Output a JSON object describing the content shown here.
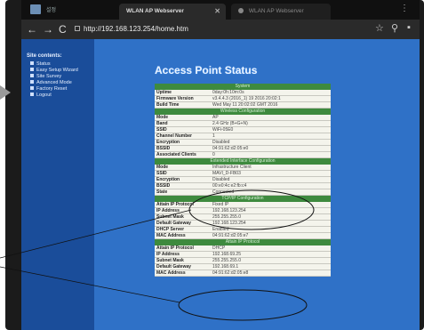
{
  "browser": {
    "app_label": "설정",
    "tab_active_title": "WLAN AP Webserver",
    "tab_inactive_title": "WLAN AP Webserver",
    "url": "http://192.168.123.254/home.htm"
  },
  "sidebar": {
    "title": "Site contents:",
    "items": [
      {
        "label": "Status"
      },
      {
        "label": "Easy Setup Wizard"
      },
      {
        "label": "Site Survey"
      },
      {
        "label": "Advanced Mode"
      },
      {
        "label": "Factory Reset"
      },
      {
        "label": "Logout"
      }
    ]
  },
  "main": {
    "title": "Access Point Status"
  },
  "sections": [
    {
      "header": "System",
      "rows": [
        {
          "key": "Uptime",
          "value": "0day:0h:10m:0s"
        },
        {
          "key": "Firmware Version",
          "value": "v3.4.4.3 (2016_1) 19 2016 20:02:1"
        },
        {
          "key": "Build Time",
          "value": "Wed May 11 20:02:02 GMT 2016"
        }
      ]
    },
    {
      "header": "Wireless Configuration",
      "rows": [
        {
          "key": "Mode",
          "value": "AP"
        },
        {
          "key": "Band",
          "value": "2.4 GHz (B+G+N)"
        },
        {
          "key": "SSID",
          "value": "WiFi-05E0"
        },
        {
          "key": "Channel Number",
          "value": "1"
        },
        {
          "key": "Encryption",
          "value": "Disabled"
        },
        {
          "key": "BSSID",
          "value": "04:91:62:d2:05:e0"
        },
        {
          "key": "Associated Clients",
          "value": "0"
        }
      ]
    },
    {
      "header": "Extended Interface Configuration",
      "rows": [
        {
          "key": "Mode",
          "value": "Infrastructure Client"
        },
        {
          "key": "SSID",
          "value": "MAVI_D-FB03"
        },
        {
          "key": "Encryption",
          "value": "Disabled"
        },
        {
          "key": "BSSID",
          "value": "00:e0:4c:e2:fb:c4"
        },
        {
          "key": "State",
          "value": "Connected"
        }
      ]
    },
    {
      "header": "TCP/IP Configuration",
      "rows": [
        {
          "key": "Attain IP Protocol",
          "value": "Fixed IP"
        },
        {
          "key": "IP Address",
          "value": "192.168.123.254"
        },
        {
          "key": "Subnet Mask",
          "value": "255.255.255.0"
        },
        {
          "key": "Default Gateway",
          "value": "192.168.123.254"
        },
        {
          "key": "DHCP Server",
          "value": "Enabled"
        },
        {
          "key": "MAC Address",
          "value": "04:91:62:d2:05:e7"
        }
      ]
    },
    {
      "header": "Attain IP Protocol",
      "rows": [
        {
          "key": "Attain IP Protocol",
          "value": "DHCP"
        },
        {
          "key": "IP Address",
          "value": "192.168.69.25"
        },
        {
          "key": "Subnet Mask",
          "value": "255.255.255.0"
        },
        {
          "key": "Default Gateway",
          "value": "192.168.69.1"
        },
        {
          "key": "MAC Address",
          "value": "04:91:62:d2:05:e8"
        }
      ]
    }
  ],
  "colors": {
    "page_bg": "#2f71c7",
    "sidebar_bg": "#1a4d9a",
    "section_header": "#3e8a3e",
    "row_bg": "#f4f4ec"
  }
}
